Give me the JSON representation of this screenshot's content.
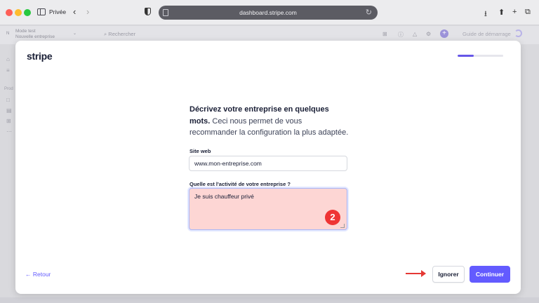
{
  "browser": {
    "private_label": "Privée",
    "url": "dashboard.stripe.com"
  },
  "dashboard": {
    "initial": "N",
    "mode_line1": "Mode test",
    "mode_line2": "Nouvelle entreprise",
    "search_placeholder": "Rechercher",
    "guide_label": "Guide de démarrage",
    "side_label": "Prod"
  },
  "modal": {
    "logo": "stripe",
    "progress": 0.35,
    "heading_bold": "Décrivez votre entreprise en quelques mots.",
    "heading_rest": " Ceci nous permet de vous recommander la configuration la plus adaptée.",
    "site_label": "Site web",
    "site_value": "www.mon-entreprise.com",
    "activity_label": "Quelle est l'activité de votre entreprise ?",
    "activity_value": "Je suis chauffeur privé",
    "badge": "2",
    "back_label": "← Retour",
    "ignore_label": "Ignorer",
    "continue_label": "Continuer"
  },
  "colors": {
    "accent": "#635bff",
    "highlight": "#fdd6d4",
    "annotation": "#e53935"
  }
}
